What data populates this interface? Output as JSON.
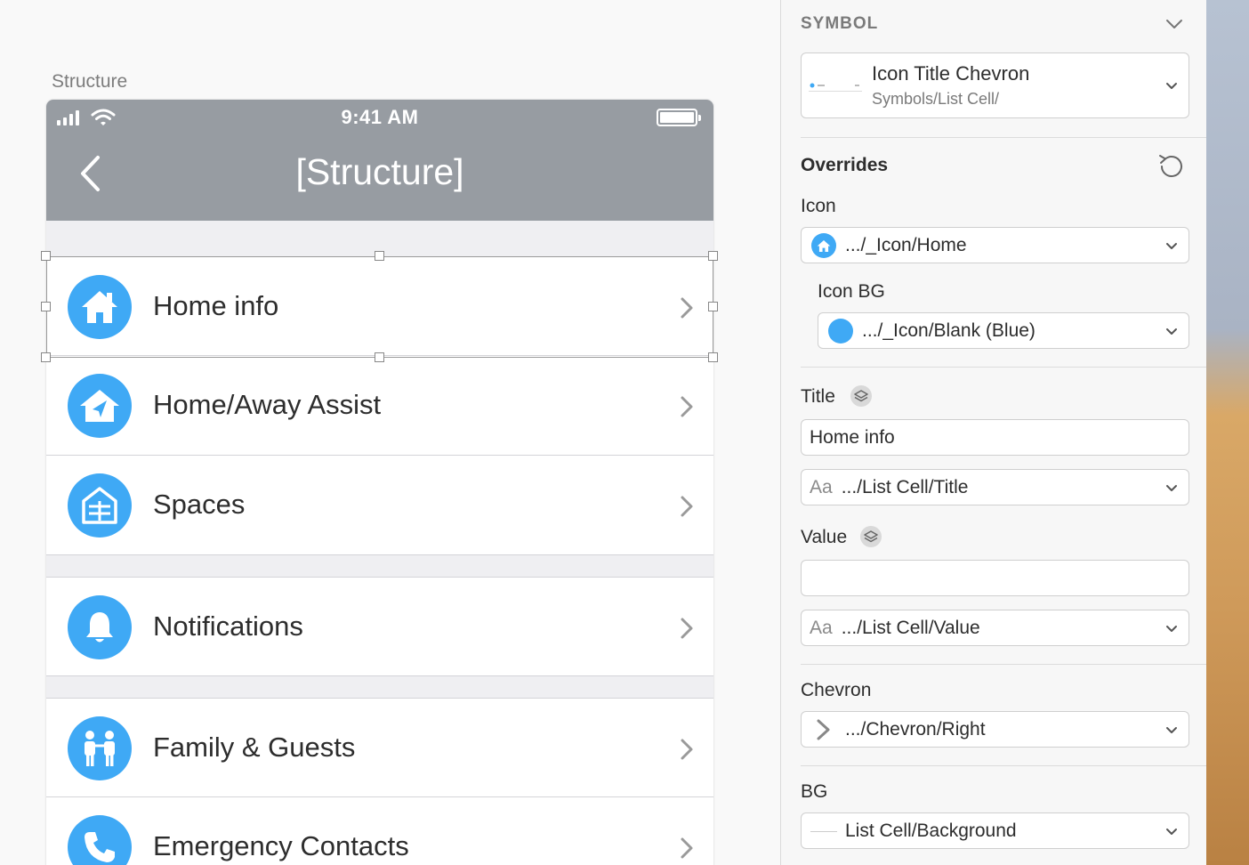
{
  "canvas": {
    "artboard_label": "Structure",
    "status": {
      "time": "9:41 AM"
    },
    "nav_title": "[Structure]",
    "cells": [
      {
        "title": "Home info",
        "icon": "home-icon"
      },
      {
        "title": "Home/Away Assist",
        "icon": "home-away-icon"
      },
      {
        "title": "Spaces",
        "icon": "spaces-icon"
      },
      {
        "title": "Notifications",
        "icon": "bell-icon"
      },
      {
        "title": "Family & Guests",
        "icon": "family-icon"
      },
      {
        "title": "Emergency Contacts",
        "icon": "phone-icon"
      }
    ],
    "accent": "#3fa9f5",
    "navbar_color": "#979ca2"
  },
  "inspector": {
    "symbol_header": "SYMBOL",
    "symbol": {
      "name": "Icon Title Chevron",
      "path": "Symbols/List Cell/"
    },
    "overrides_header": "Overrides",
    "icon": {
      "label": "Icon",
      "value": ".../_Icon/Home"
    },
    "icon_bg": {
      "label": "Icon BG",
      "value": ".../_Icon/Blank (Blue)"
    },
    "title": {
      "label": "Title",
      "value": "Home info",
      "style_prefix": "Aa",
      "style": ".../List Cell/Title"
    },
    "value": {
      "label": "Value",
      "value": "",
      "style_prefix": "Aa",
      "style": ".../List Cell/Value"
    },
    "chevron": {
      "label": "Chevron",
      "value": ".../Chevron/Right"
    },
    "bg": {
      "label": "BG",
      "value": "List Cell/Background"
    }
  }
}
